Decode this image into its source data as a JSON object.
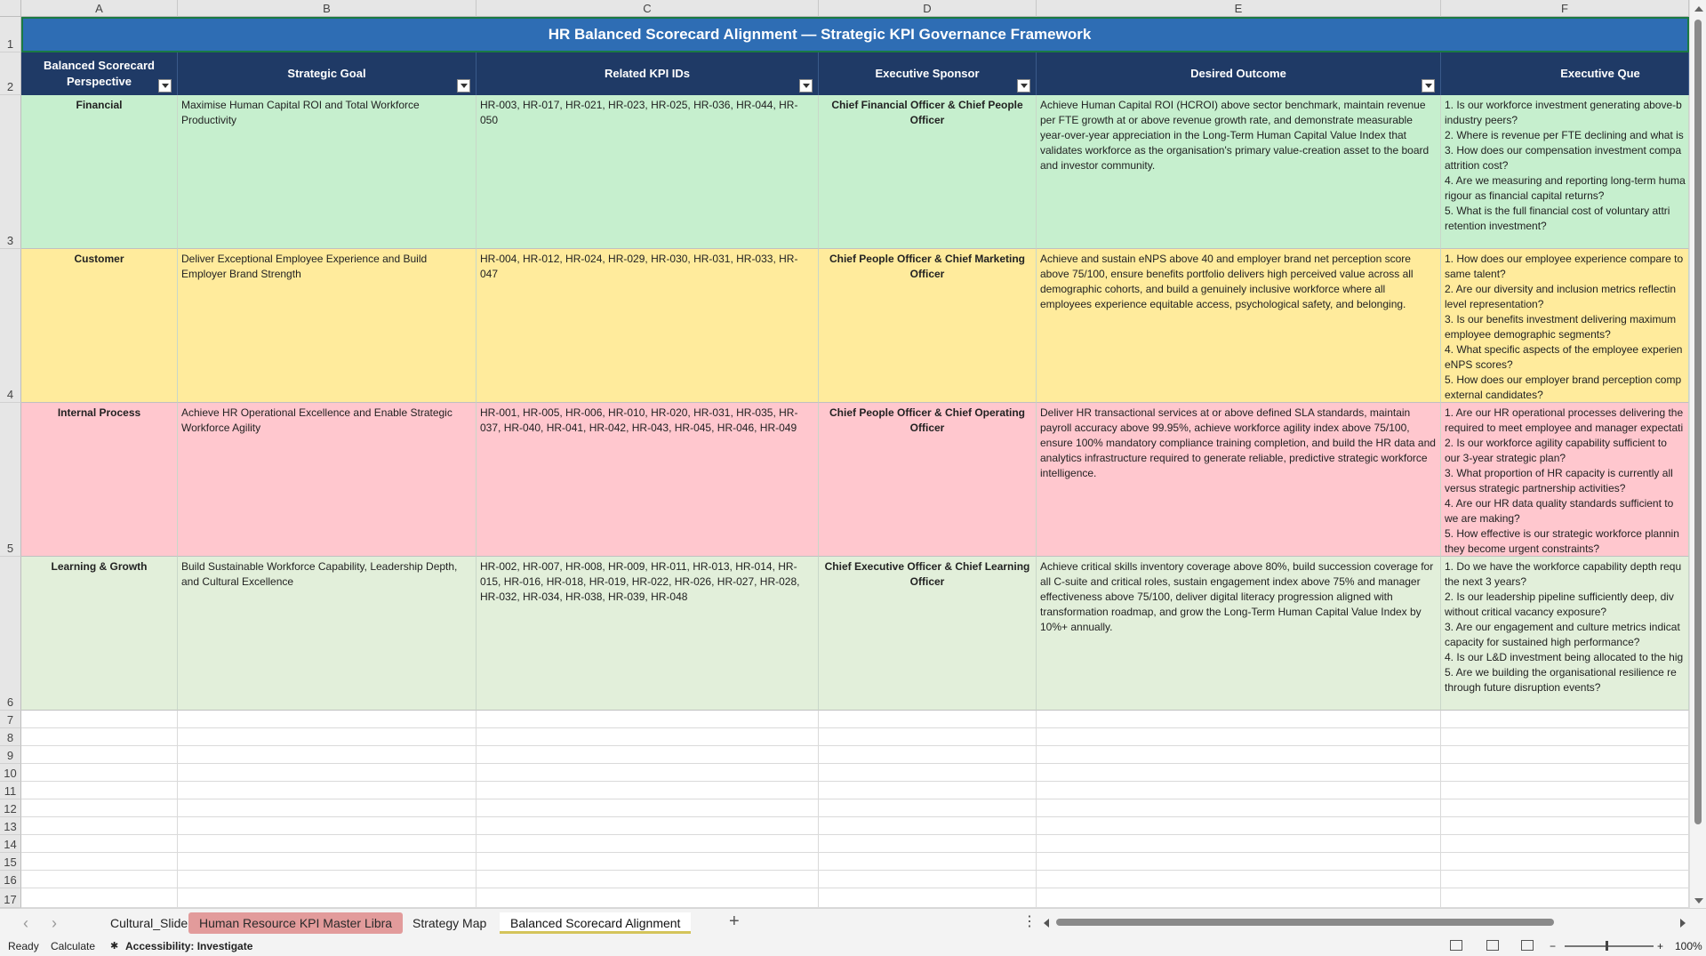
{
  "columns": [
    "A",
    "B",
    "C",
    "D",
    "E",
    "F"
  ],
  "rows": [
    "1",
    "2",
    "3",
    "4",
    "5",
    "6",
    "7",
    "8",
    "9",
    "10",
    "11",
    "12",
    "13",
    "14",
    "15",
    "16",
    "17"
  ],
  "title": "HR Balanced Scorecard Alignment — Strategic KPI Governance Framework",
  "headers": [
    "Balanced Scorecard Perspective",
    "Strategic Goal",
    "Related KPI IDs",
    "Executive Sponsor",
    "Desired Outcome",
    "Executive Que"
  ],
  "data_rows": [
    {
      "perspective": "Financial",
      "goal": "Maximise Human Capital ROI and Total Workforce Productivity",
      "kpis": "HR-003, HR-017, HR-021, HR-023, HR-025, HR-036, HR-044, HR-050",
      "sponsor": "Chief Financial Officer & Chief People Officer",
      "outcome": "Achieve Human Capital ROI (HCROI) above sector benchmark, maintain revenue per FTE growth at or above revenue growth rate, and demonstrate measurable year-over-year appreciation in the Long-Term Human Capital Value Index that validates workforce as the organisation's primary value-creation asset to the board and investor community.",
      "questions": [
        "1. Is our workforce investment generating above-b",
        "industry peers?",
        "2. Where is revenue per FTE declining and what is",
        "3. How does our compensation investment compa",
        "attrition cost?",
        "4. Are we measuring and reporting long-term huma",
        "rigour as financial capital returns?",
        "5. What is the full financial cost of voluntary attri",
        "retention investment?"
      ],
      "color": "#c6efce"
    },
    {
      "perspective": "Customer",
      "goal": "Deliver Exceptional Employee Experience and Build Employer Brand Strength",
      "kpis": "HR-004, HR-012, HR-024, HR-029, HR-030, HR-031, HR-033, HR-047",
      "sponsor": "Chief People Officer & Chief Marketing Officer",
      "outcome": "Achieve and sustain eNPS above 40 and employer brand net perception score above 75/100, ensure benefits portfolio delivers high perceived value across all demographic cohorts, and build a genuinely inclusive workforce where all employees experience equitable access, psychological safety, and belonging.",
      "questions": [
        "1. How does our employee experience compare to",
        "same talent?",
        "2. Are our diversity and inclusion metrics reflectin",
        "level representation?",
        "3. Is our benefits investment delivering maximum",
        "employee demographic segments?",
        "4. What specific aspects of the employee experien",
        "eNPS scores?",
        "5. How does our employer brand perception comp",
        "external candidates?"
      ],
      "color": "#ffeb9c"
    },
    {
      "perspective": "Internal Process",
      "goal": "Achieve HR Operational Excellence and Enable Strategic Workforce Agility",
      "kpis": "HR-001, HR-005, HR-006, HR-010, HR-020, HR-031, HR-035, HR-037, HR-040, HR-041, HR-042, HR-043, HR-045, HR-046, HR-049",
      "sponsor": "Chief People Officer & Chief Operating Officer",
      "outcome": "Deliver HR transactional services at or above defined SLA standards, maintain payroll accuracy above 99.95%, achieve workforce agility index above 75/100, ensure 100% mandatory compliance training completion, and build the HR data and analytics infrastructure required to generate reliable, predictive strategic workforce intelligence.",
      "questions": [
        "1. Are our HR operational processes delivering the",
        "required to meet employee and manager expectati",
        "2. Is our workforce agility capability sufficient to",
        "our 3-year strategic plan?",
        "3. What proportion of HR capacity is currently all",
        "versus strategic partnership activities?",
        "4. Are our HR data quality standards sufficient to",
        "we are making?",
        "5. How effective is our strategic workforce plannin",
        "they become urgent constraints?"
      ],
      "color": "#ffc7ce"
    },
    {
      "perspective": "Learning & Growth",
      "goal": "Build Sustainable Workforce Capability, Leadership Depth, and Cultural Excellence",
      "kpis": "HR-002, HR-007, HR-008, HR-009, HR-011, HR-013, HR-014, HR-015, HR-016, HR-018, HR-019, HR-022, HR-026, HR-027, HR-028, HR-032, HR-034, HR-038, HR-039, HR-048",
      "sponsor": "Chief Executive Officer & Chief Learning Officer",
      "outcome": "Achieve critical skills inventory coverage above 80%, build succession coverage for all C-suite and critical roles, sustain engagement index above 75% and manager effectiveness above 75/100, deliver digital literacy progression aligned with transformation roadmap, and grow the Long-Term Human Capital Value Index by 10%+ annually.",
      "questions": [
        "1. Do we have the workforce capability depth requ",
        "the next 3 years?",
        "2. Is our leadership pipeline sufficiently deep, div",
        "without critical vacancy exposure?",
        "3. Are our engagement and culture metrics indicat",
        "capacity for sustained high performance?",
        "4. Is our L&D investment being allocated to the hig",
        "5. Are we building the organisational resilience re",
        "through future disruption events?"
      ],
      "color": "#e2efda"
    }
  ],
  "sheet_tabs": [
    {
      "label": "Cultural_Slide",
      "style": "plain"
    },
    {
      "label": "Human Resource KPI Master Libra",
      "style": "red"
    },
    {
      "label": "Strategy Map",
      "style": "plain"
    },
    {
      "label": "Balanced Scorecard Alignment",
      "style": "active"
    }
  ],
  "status": {
    "ready": "Ready",
    "calculate": "Calculate",
    "accessibility": "Accessibility: Investigate",
    "zoom": "100%"
  }
}
